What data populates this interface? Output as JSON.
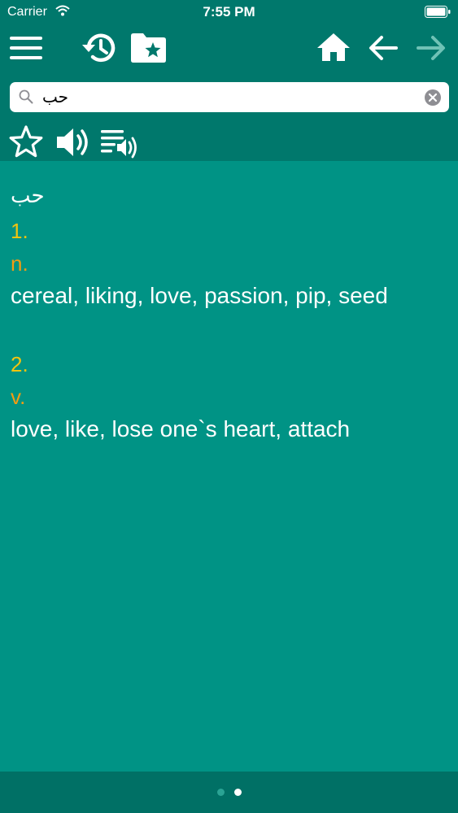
{
  "status_bar": {
    "carrier": "Carrier",
    "time": "7:55 PM"
  },
  "toolbar": {
    "icons": [
      "menu-icon",
      "history-icon",
      "favorites-folder-icon",
      "home-icon",
      "back-arrow-icon",
      "forward-arrow-icon"
    ]
  },
  "search": {
    "value": "حب",
    "placeholder": ""
  },
  "actions": {
    "icons": [
      "star-icon",
      "speaker-icon",
      "playlist-audio-icon"
    ]
  },
  "entry": {
    "headword": "حب",
    "senses": [
      {
        "number": "1.",
        "pos": "n.",
        "translation": "cereal, liking, love, passion, pip, seed"
      },
      {
        "number": "2.",
        "pos": "v.",
        "translation": "love, like, lose one`s heart, attach"
      }
    ]
  },
  "pager": {
    "count": 2,
    "active": 2
  },
  "colors": {
    "header": "#00786c",
    "content": "#009385",
    "footer": "#007065",
    "sense_number": "#f1c40f",
    "part_of_speech": "#f39c12",
    "forward_disabled": "#6fc2b6"
  }
}
